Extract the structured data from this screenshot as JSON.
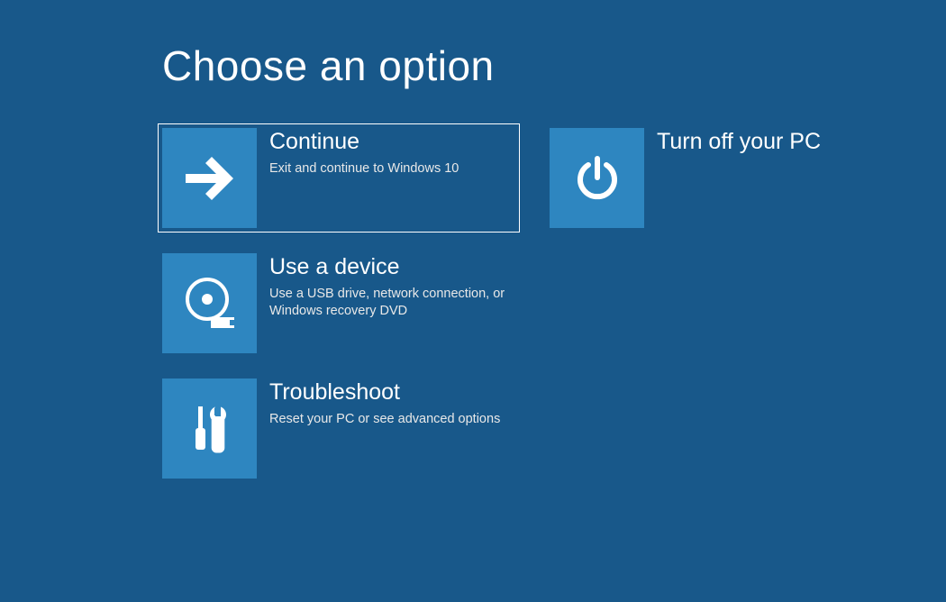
{
  "title": "Choose an option",
  "colors": {
    "background": "#18588a",
    "tile": "#2e86c0",
    "text": "#ffffff"
  },
  "options": {
    "continue": {
      "title": "Continue",
      "subtitle": "Exit and continue to Windows 10",
      "selected": true
    },
    "useDevice": {
      "title": "Use a device",
      "subtitle": "Use a USB drive, network connection, or Windows recovery DVD"
    },
    "troubleshoot": {
      "title": "Troubleshoot",
      "subtitle": "Reset your PC or see advanced options"
    },
    "turnOff": {
      "title": "Turn off your PC"
    }
  }
}
